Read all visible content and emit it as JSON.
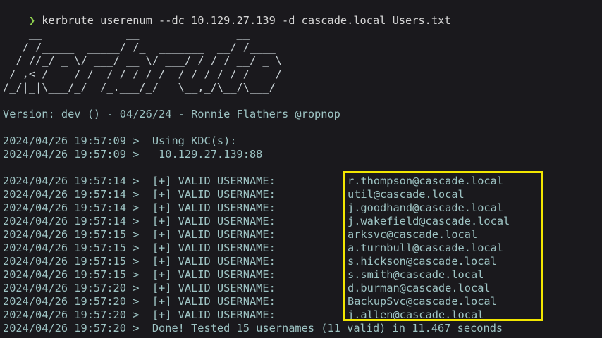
{
  "prompt": {
    "symbol": "❯",
    "command": "kerbrute userenum --dc 10.129.27.139 -d cascade.local ",
    "file_arg": "Users.txt"
  },
  "banner": [
    "    __             __               __     ",
    "   / /_____  _____/ /_  _______  __/ /____ ",
    "  / //_/ _ \\/ ___/ __ \\/ ___/ / / / __/ _ \\",
    " / ,< /  __/ /  / /_/ / /  / /_/ / /_/  __/",
    "/_/|_|\\___/_/  /_.___/_/   \\__,_/\\__/\\___/ "
  ],
  "version_line": "Version: dev () - 04/26/24 - Ronnie Flathers @ropnop",
  "kdc_lines": [
    "2024/04/26 19:57:09 >  Using KDC(s):",
    "2024/04/26 19:57:09 >   10.129.27.139:88"
  ],
  "valid_label": "[+] VALID USERNAME:",
  "results": [
    {
      "ts": "2024/04/26 19:57:14 >",
      "user": "r.thompson@cascade.local"
    },
    {
      "ts": "2024/04/26 19:57:14 >",
      "user": "util@cascade.local"
    },
    {
      "ts": "2024/04/26 19:57:14 >",
      "user": "j.goodhand@cascade.local"
    },
    {
      "ts": "2024/04/26 19:57:14 >",
      "user": "j.wakefield@cascade.local"
    },
    {
      "ts": "2024/04/26 19:57:15 >",
      "user": "arksvc@cascade.local"
    },
    {
      "ts": "2024/04/26 19:57:15 >",
      "user": "a.turnbull@cascade.local"
    },
    {
      "ts": "2024/04/26 19:57:15 >",
      "user": "s.hickson@cascade.local"
    },
    {
      "ts": "2024/04/26 19:57:15 >",
      "user": "s.smith@cascade.local"
    },
    {
      "ts": "2024/04/26 19:57:20 >",
      "user": "d.burman@cascade.local"
    },
    {
      "ts": "2024/04/26 19:57:20 >",
      "user": "BackupSvc@cascade.local"
    },
    {
      "ts": "2024/04/26 19:57:20 >",
      "user": "j.allen@cascade.local"
    }
  ],
  "done_line": "2024/04/26 19:57:20 >  Done! Tested 15 usernames (11 valid) in 11.467 seconds",
  "colors": {
    "background": "#1a191d",
    "text": "#9ec4c4",
    "prompt": "#8fd14f",
    "highlight_box": "#f2e600"
  }
}
